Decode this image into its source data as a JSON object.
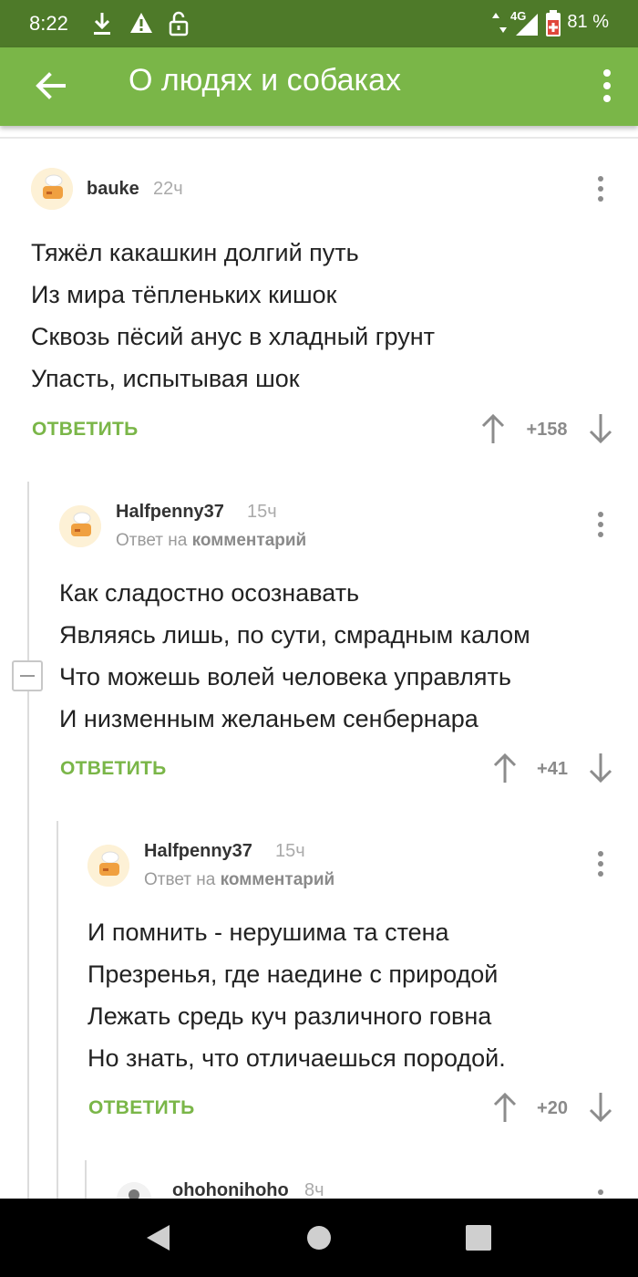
{
  "status_bar": {
    "time": "8:22",
    "network": "4G",
    "battery": "81 %"
  },
  "app_bar": {
    "title": "О людях и собаках",
    "back_icon": "arrow-left-icon",
    "menu_icon": "more-vertical-icon"
  },
  "comments": [
    {
      "username": "bauke",
      "time": "22ч",
      "lines": [
        "Тяжёл какашкин долгий путь",
        "Из мира тёпленьких кишок",
        "Сквозь пёсий анус в хладный грунт",
        "Упасть, испытывая шок"
      ],
      "reply_label": "ОТВЕТИТЬ",
      "score": "+158"
    },
    {
      "username": "Halfpenny37",
      "time": "15ч",
      "reply_prefix": "Ответ на",
      "reply_target": "комментарий",
      "lines": [
        "Как сладостно осознавать",
        "Являясь лишь, по сути, смрадным калом",
        "Что можешь волей человека управлять",
        "И низменным желаньем сенбернара"
      ],
      "reply_label": "ОТВЕТИТЬ",
      "score": "+41"
    },
    {
      "username": "Halfpenny37",
      "time": "15ч",
      "reply_prefix": "Ответ на",
      "reply_target": "комментарий",
      "lines": [
        "И помнить - нерушима та стена",
        "Презренья, где наедине с природой",
        "Лежать средь куч различного говна",
        "Но знать, что отличаешься породой."
      ],
      "reply_label": "ОТВЕТИТЬ",
      "score": "+20"
    },
    {
      "username": "ohohonihoho",
      "time": "8ч"
    }
  ],
  "colors": {
    "status_bar": "#4e7a29",
    "app_bar": "#7ab648",
    "accent": "#7ab648"
  }
}
